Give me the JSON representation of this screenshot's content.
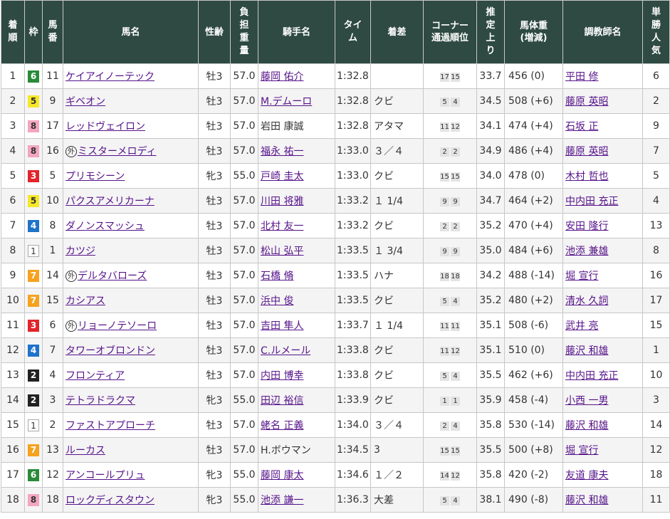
{
  "headers": {
    "rank": "着順",
    "waku": "枠",
    "num": "馬番",
    "horse": "馬名",
    "sex_age": "性齢",
    "weight": "負担重量",
    "jockey": "騎手名",
    "time": "タイム",
    "margin": "着差",
    "corner_l1": "コーナー",
    "corner_l2": "通過順位",
    "f3": "推定上り",
    "body_l1": "馬体重",
    "body_l2": "(増減)",
    "trainer": "調教師名",
    "pop": "単勝人気"
  },
  "foreign_mark": "外",
  "rows": [
    {
      "rank": "1",
      "waku": "6",
      "num": "11",
      "foreign": false,
      "horse": "ケイアイノーテック",
      "sex_age": "牡3",
      "weight": "57.0",
      "jockey": "藤岡 佑介",
      "jockey_link": true,
      "time": "1:32.8",
      "margin": "",
      "corner1": "17",
      "corner2": "15",
      "f3": "33.7",
      "body": "456",
      "diff": "(0)",
      "trainer": "平田 修",
      "pop": "6"
    },
    {
      "rank": "2",
      "waku": "5",
      "num": "9",
      "foreign": false,
      "horse": "ギベオン",
      "sex_age": "牡3",
      "weight": "57.0",
      "jockey": "M.デムーロ",
      "jockey_link": true,
      "time": "1:32.8",
      "margin": "クビ",
      "corner1": "5",
      "corner2": "4",
      "f3": "34.5",
      "body": "508",
      "diff": "(+6)",
      "trainer": "藤原 英昭",
      "pop": "2"
    },
    {
      "rank": "3",
      "waku": "8",
      "num": "17",
      "foreign": false,
      "horse": "レッドヴェイロン",
      "sex_age": "牡3",
      "weight": "57.0",
      "jockey": "岩田 康誠",
      "jockey_link": false,
      "time": "1:32.8",
      "margin": "アタマ",
      "corner1": "11",
      "corner2": "12",
      "f3": "34.1",
      "body": "474",
      "diff": "(+4)",
      "trainer": "石坂 正",
      "pop": "9"
    },
    {
      "rank": "4",
      "waku": "8",
      "num": "16",
      "foreign": true,
      "horse": "ミスターメロディ",
      "sex_age": "牡3",
      "weight": "57.0",
      "jockey": "福永 祐一",
      "jockey_link": true,
      "time": "1:33.0",
      "margin": "３／４",
      "corner1": "2",
      "corner2": "2",
      "f3": "34.9",
      "body": "486",
      "diff": "(+4)",
      "trainer": "藤原 英昭",
      "pop": "7"
    },
    {
      "rank": "5",
      "waku": "3",
      "num": "5",
      "foreign": false,
      "horse": "プリモシーン",
      "sex_age": "牝3",
      "weight": "55.0",
      "jockey": "戸崎 圭太",
      "jockey_link": true,
      "time": "1:33.0",
      "margin": "クビ",
      "corner1": "15",
      "corner2": "15",
      "f3": "34.0",
      "body": "478",
      "diff": "(0)",
      "trainer": "木村 哲也",
      "pop": "5"
    },
    {
      "rank": "6",
      "waku": "5",
      "num": "10",
      "foreign": false,
      "horse": "パクスアメリカーナ",
      "sex_age": "牡3",
      "weight": "57.0",
      "jockey": "川田 将雅",
      "jockey_link": true,
      "time": "1:33.2",
      "margin": "１ 1/4",
      "corner1": "9",
      "corner2": "9",
      "f3": "34.7",
      "body": "464",
      "diff": "(+2)",
      "trainer": "中内田 充正",
      "pop": "4"
    },
    {
      "rank": "7",
      "waku": "4",
      "num": "8",
      "foreign": false,
      "horse": "ダノンスマッシュ",
      "sex_age": "牡3",
      "weight": "57.0",
      "jockey": "北村 友一",
      "jockey_link": true,
      "time": "1:33.2",
      "margin": "クビ",
      "corner1": "2",
      "corner2": "2",
      "f3": "35.2",
      "body": "470",
      "diff": "(+4)",
      "trainer": "安田 隆行",
      "pop": "13"
    },
    {
      "rank": "8",
      "waku": "1",
      "num": "1",
      "foreign": false,
      "horse": "カツジ",
      "sex_age": "牡3",
      "weight": "57.0",
      "jockey": "松山 弘平",
      "jockey_link": true,
      "time": "1:33.5",
      "margin": "１ 3/4",
      "corner1": "9",
      "corner2": "9",
      "f3": "35.0",
      "body": "484",
      "diff": "(+6)",
      "trainer": "池添 兼雄",
      "pop": "8"
    },
    {
      "rank": "9",
      "waku": "7",
      "num": "14",
      "foreign": true,
      "horse": "デルタバローズ",
      "sex_age": "牡3",
      "weight": "57.0",
      "jockey": "石橋 脩",
      "jockey_link": true,
      "time": "1:33.5",
      "margin": "ハナ",
      "corner1": "18",
      "corner2": "18",
      "f3": "34.2",
      "body": "488",
      "diff": "(-14)",
      "trainer": "堀 宣行",
      "pop": "16"
    },
    {
      "rank": "10",
      "waku": "7",
      "num": "15",
      "foreign": false,
      "horse": "カシアス",
      "sex_age": "牡3",
      "weight": "57.0",
      "jockey": "浜中 俊",
      "jockey_link": true,
      "time": "1:33.5",
      "margin": "クビ",
      "corner1": "5",
      "corner2": "4",
      "f3": "35.2",
      "body": "480",
      "diff": "(+2)",
      "trainer": "清水 久詞",
      "pop": "17"
    },
    {
      "rank": "11",
      "waku": "3",
      "num": "6",
      "foreign": true,
      "horse": "リョーノテソーロ",
      "sex_age": "牡3",
      "weight": "57.0",
      "jockey": "吉田 隼人",
      "jockey_link": true,
      "time": "1:33.7",
      "margin": "１ 1/4",
      "corner1": "11",
      "corner2": "11",
      "f3": "35.1",
      "body": "508",
      "diff": "(-6)",
      "trainer": "武井 亮",
      "pop": "15"
    },
    {
      "rank": "12",
      "waku": "4",
      "num": "7",
      "foreign": false,
      "horse": "タワーオブロンドン",
      "sex_age": "牡3",
      "weight": "57.0",
      "jockey": "C.ルメール",
      "jockey_link": true,
      "time": "1:33.8",
      "margin": "クビ",
      "corner1": "11",
      "corner2": "12",
      "f3": "35.1",
      "body": "510",
      "diff": "(0)",
      "trainer": "藤沢 和雄",
      "pop": "1"
    },
    {
      "rank": "13",
      "waku": "2",
      "num": "4",
      "foreign": false,
      "horse": "フロンティア",
      "sex_age": "牡3",
      "weight": "57.0",
      "jockey": "内田 博幸",
      "jockey_link": true,
      "time": "1:33.8",
      "margin": "クビ",
      "corner1": "5",
      "corner2": "4",
      "f3": "35.5",
      "body": "462",
      "diff": "(+6)",
      "trainer": "中内田 充正",
      "pop": "10"
    },
    {
      "rank": "14",
      "waku": "2",
      "num": "3",
      "foreign": false,
      "horse": "テトラドラクマ",
      "sex_age": "牝3",
      "weight": "55.0",
      "jockey": "田辺 裕信",
      "jockey_link": true,
      "time": "1:33.9",
      "margin": "クビ",
      "corner1": "1",
      "corner2": "1",
      "f3": "35.9",
      "body": "458",
      "diff": "(-4)",
      "trainer": "小西 一男",
      "pop": "3"
    },
    {
      "rank": "15",
      "waku": "1",
      "num": "2",
      "foreign": false,
      "horse": "ファストアプローチ",
      "sex_age": "牡3",
      "weight": "57.0",
      "jockey": "蛯名 正義",
      "jockey_link": true,
      "time": "1:34.0",
      "margin": "３／４",
      "corner1": "2",
      "corner2": "4",
      "f3": "35.8",
      "body": "530",
      "diff": "(-14)",
      "trainer": "藤沢 和雄",
      "pop": "14"
    },
    {
      "rank": "16",
      "waku": "7",
      "num": "13",
      "foreign": false,
      "horse": "ルーカス",
      "sex_age": "牡3",
      "weight": "57.0",
      "jockey": "H.ボウマン",
      "jockey_link": false,
      "time": "1:34.5",
      "margin": "3",
      "corner1": "15",
      "corner2": "15",
      "f3": "35.5",
      "body": "500",
      "diff": "(+8)",
      "trainer": "堀 宣行",
      "pop": "12"
    },
    {
      "rank": "17",
      "waku": "6",
      "num": "12",
      "foreign": false,
      "horse": "アンコールプリュ",
      "sex_age": "牝3",
      "weight": "55.0",
      "jockey": "藤岡 康太",
      "jockey_link": true,
      "time": "1:34.6",
      "margin": "１／２",
      "corner1": "14",
      "corner2": "12",
      "f3": "35.8",
      "body": "420",
      "diff": "(-2)",
      "trainer": "友道 康夫",
      "pop": "18"
    },
    {
      "rank": "18",
      "waku": "8",
      "num": "18",
      "foreign": false,
      "horse": "ロックディスタウン",
      "sex_age": "牝3",
      "weight": "55.0",
      "jockey": "池添 謙一",
      "jockey_link": true,
      "time": "1:36.3",
      "margin": "大差",
      "corner1": "5",
      "corner2": "4",
      "f3": "38.1",
      "body": "490",
      "diff": "(-8)",
      "trainer": "藤沢 和雄",
      "pop": "11"
    }
  ]
}
